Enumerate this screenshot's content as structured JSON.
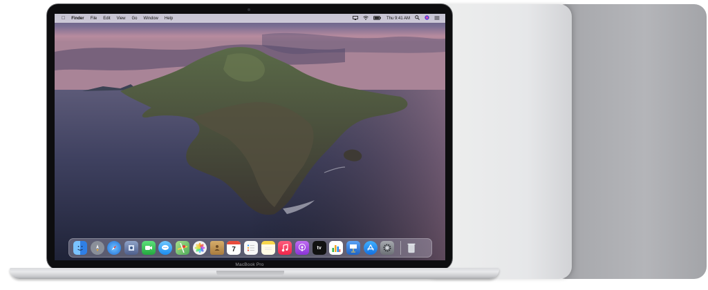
{
  "device": {
    "model_label": "MacBook Pro"
  },
  "menubar": {
    "apple_icon": "apple-logo-icon",
    "items": [
      "Finder",
      "File",
      "Edit",
      "View",
      "Go",
      "Window",
      "Help"
    ],
    "clock": "Thu 9:41 AM",
    "status_icons": [
      "airplay-icon",
      "wifi-icon",
      "battery-icon",
      "search-icon",
      "siri-icon",
      "control-center-icon"
    ]
  },
  "dock": {
    "apps": [
      {
        "name": "Finder",
        "icon": "finder-icon",
        "color": "#3d8ff2"
      },
      {
        "name": "Launchpad",
        "icon": "launchpad-icon",
        "color": "#8a8f99"
      },
      {
        "name": "Safari",
        "icon": "safari-icon",
        "color": "#2a8be6"
      },
      {
        "name": "Photo Booth",
        "icon": "photo-booth-icon",
        "color": "#5a6f9e"
      },
      {
        "name": "FaceTime",
        "icon": "facetime-icon",
        "color": "#2fc24a"
      },
      {
        "name": "Messages",
        "icon": "messages-icon",
        "color": "#2e9ff5"
      },
      {
        "name": "Maps",
        "icon": "maps-icon",
        "color": "#6cc56a"
      },
      {
        "name": "Photos",
        "icon": "photos-icon",
        "color": "#f2f2f2"
      },
      {
        "name": "Contacts",
        "icon": "contacts-icon",
        "color": "#c49a5a"
      },
      {
        "name": "Calendar",
        "icon": "calendar-icon",
        "color": "#ffffff"
      },
      {
        "name": "Reminders",
        "icon": "reminders-icon",
        "color": "#f5f5f5"
      },
      {
        "name": "Notes",
        "icon": "notes-icon",
        "color": "#f7d64a"
      },
      {
        "name": "Music",
        "icon": "music-icon",
        "color": "#fa3d5c"
      },
      {
        "name": "Podcasts",
        "icon": "podcasts-icon",
        "color": "#9b4de0"
      },
      {
        "name": "TV",
        "icon": "apple-tv-icon",
        "color": "#111111"
      },
      {
        "name": "Numbers",
        "icon": "numbers-icon",
        "color": "#ffffff"
      },
      {
        "name": "Keynote",
        "icon": "keynote-icon",
        "color": "#2f7ad8"
      },
      {
        "name": "App Store",
        "icon": "app-store-icon",
        "color": "#1e8ff5"
      },
      {
        "name": "System Preferences",
        "icon": "system-preferences-icon",
        "color": "#8d9096"
      }
    ],
    "trash": {
      "name": "Trash",
      "icon": "trash-icon",
      "color": "#d9dde2"
    },
    "calendar_day": "7",
    "tv_label": "tv"
  },
  "colors": {
    "silver": "#e6e7e9",
    "space_gray": "#b0b1b5",
    "bezel": "#0d0d0f"
  }
}
